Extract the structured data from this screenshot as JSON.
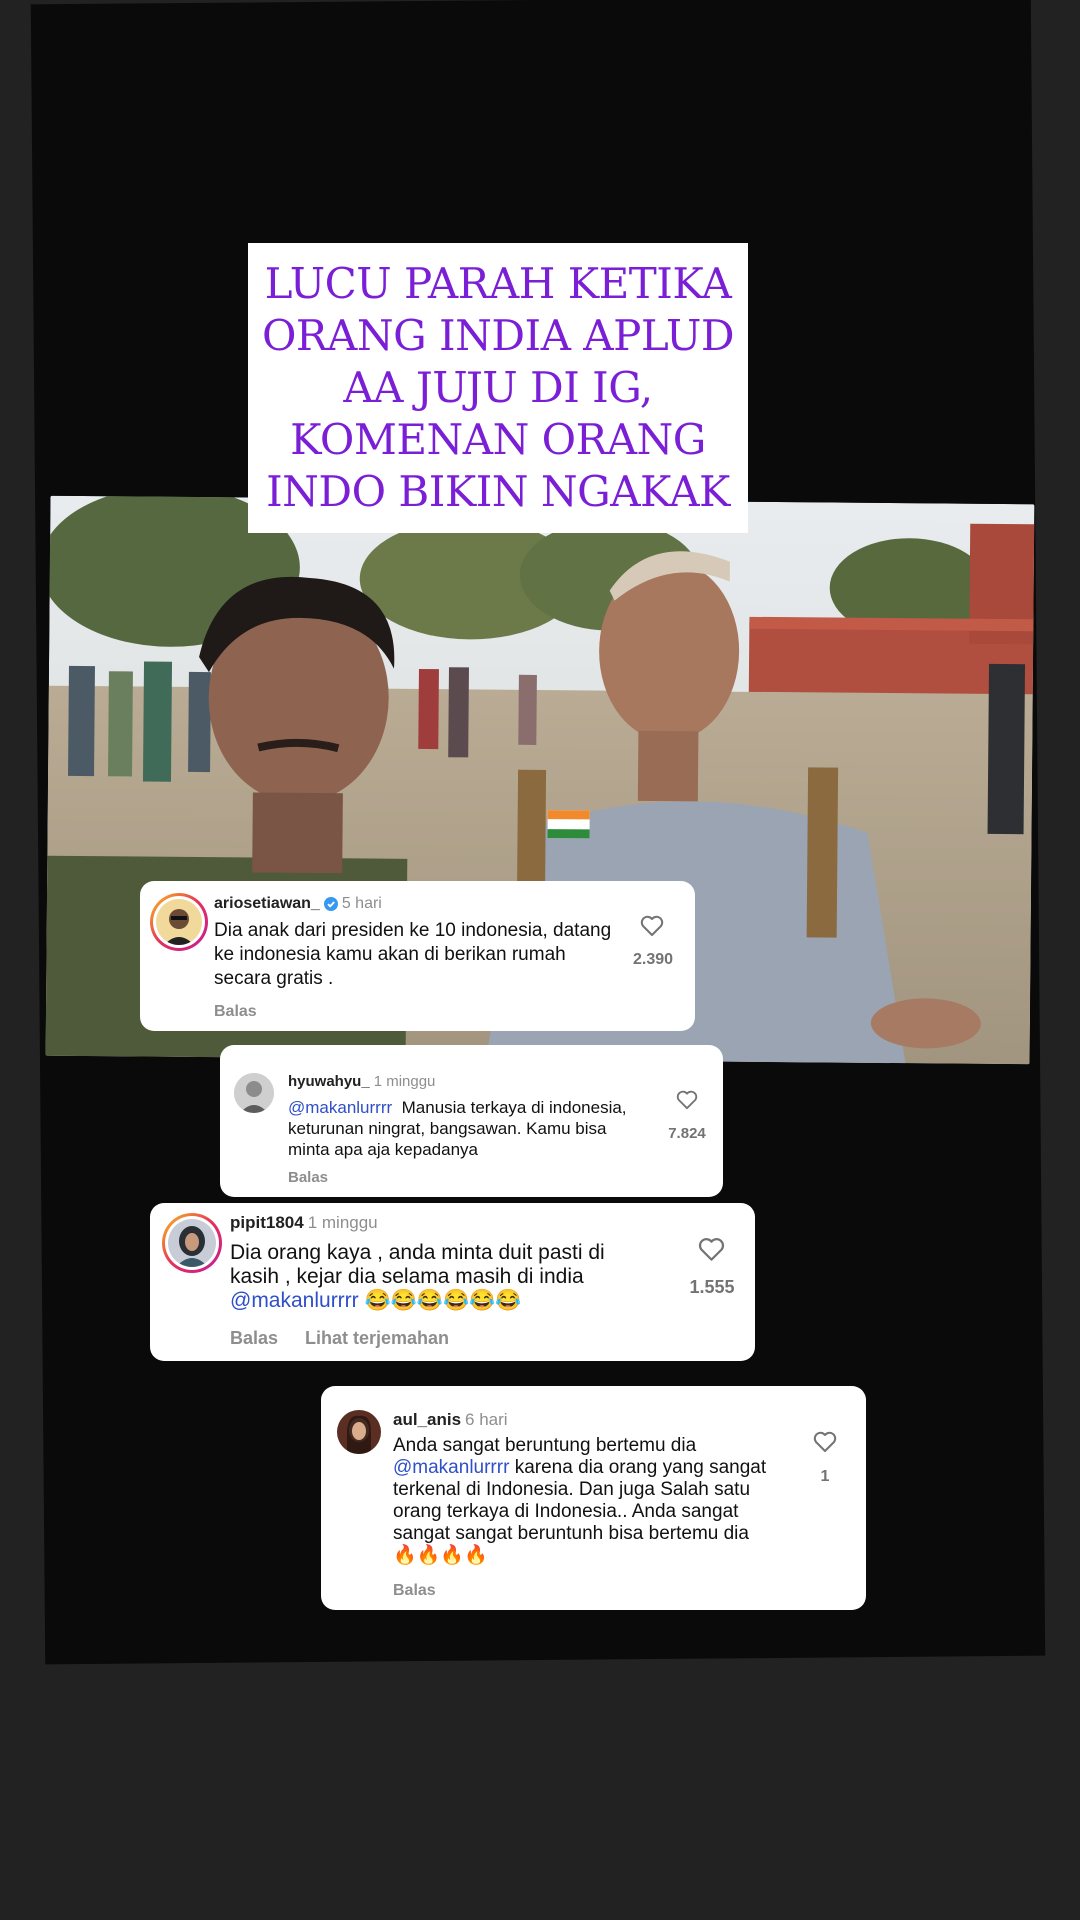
{
  "title": "LUCU PARAH KETIKA ORANG INDIA APLUD AA JUJU DI IG, KOMENAN ORANG INDO BIKIN NGAKAK",
  "comments": [
    {
      "username": "ariosetiawan_",
      "time": "5 hari",
      "verified": true,
      "text": "Dia anak dari presiden ke 10 indonesia, datang ke indonesia kamu akan di berikan rumah secara gratis .",
      "likes": "2.390",
      "reply": "Balas"
    },
    {
      "username": "hyuwahyu_",
      "time": "1 minggu",
      "mention": "@makanlurrrr",
      "text": "Manusia terkaya di indonesia, keturunan ningrat, bangsawan. Kamu bisa minta apa aja kepadanya",
      "likes": "7.824",
      "reply": "Balas"
    },
    {
      "username": "pipit1804",
      "time": "1 minggu",
      "text": "Dia orang kaya , anda minta duit pasti di kasih , kejar dia selama masih di india",
      "mention": "@makanlurrrr",
      "emojis": "😂😂😂😂😂😂",
      "likes": "1.555",
      "reply": "Balas",
      "translate": "Lihat terjemahan"
    },
    {
      "username": "aul_anis",
      "time": "6 hari",
      "text_before": "Anda sangat beruntung bertemu dia",
      "mention": "@makanlurrrr",
      "text_after": "karena dia orang yang sangat terkenal di Indonesia. Dan juga Salah satu orang terkaya di Indonesia.. Anda sangat sangat sangat beruntunh bisa bertemu dia",
      "emojis": "🔥🔥🔥🔥",
      "likes": "1",
      "reply": "Balas"
    }
  ],
  "colors": {
    "title": "#7a1fd6",
    "mention": "#2f4fc9",
    "verified": "#3897f0"
  }
}
